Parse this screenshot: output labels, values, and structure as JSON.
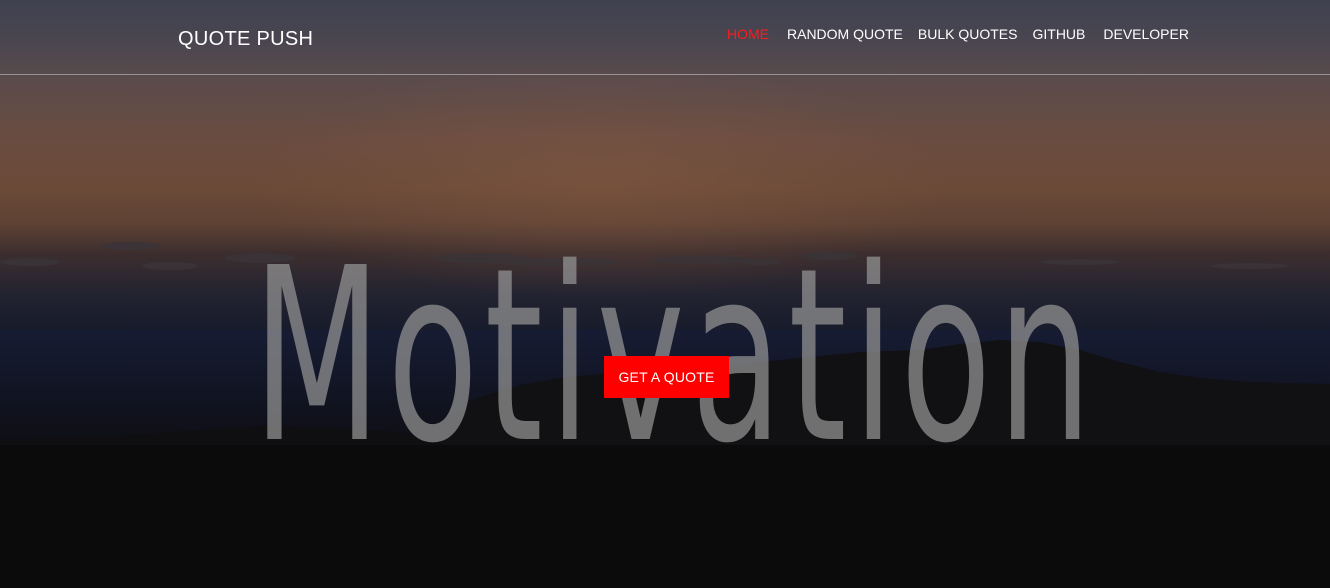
{
  "brand": {
    "name": "QUOTE PUSH"
  },
  "nav": {
    "items": [
      {
        "label": "HOME",
        "active": true
      },
      {
        "label": "RANDOM QUOTE",
        "active": false
      },
      {
        "label": "BULK QUOTES",
        "active": false
      },
      {
        "label": "GITHUB",
        "active": false
      },
      {
        "label": "DEVELOPER",
        "active": false
      }
    ]
  },
  "hero": {
    "background_word": "Motivation",
    "cta_label": "GET A QUOTE"
  },
  "colors": {
    "accent": "#ff0000",
    "active_nav": "#ff1a1a",
    "text": "#ffffff",
    "background_word": "#969696"
  }
}
